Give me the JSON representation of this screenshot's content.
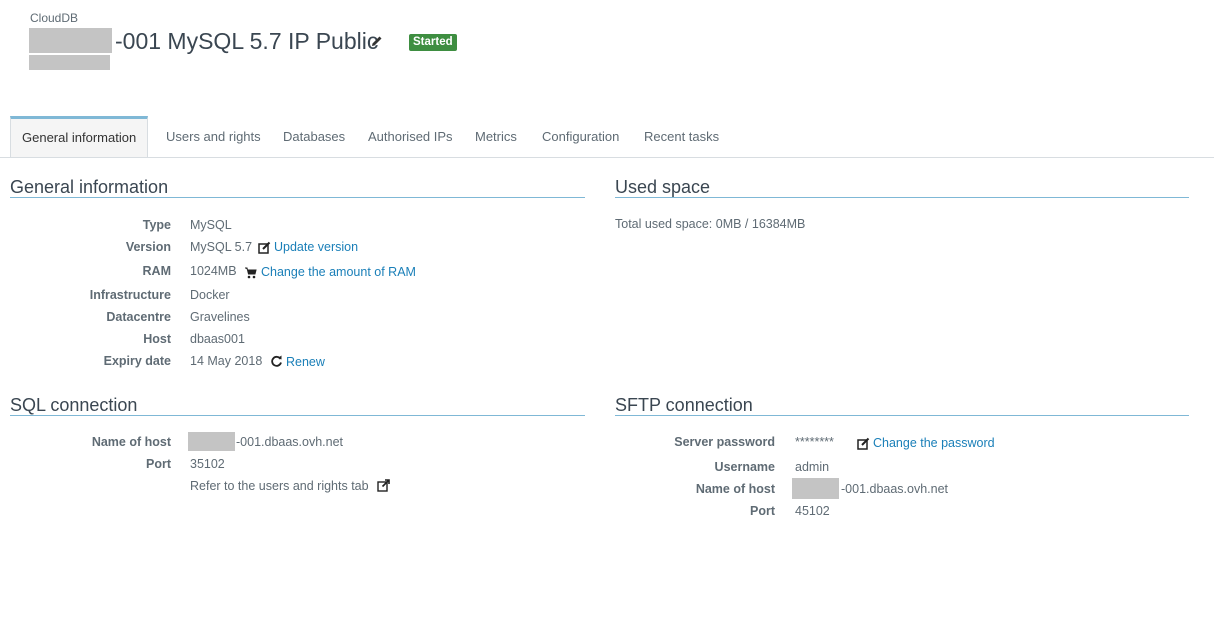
{
  "header": {
    "service_type": "CloudDB",
    "title_suffix": "-001 MySQL 5.7 IP Public",
    "status": "Started"
  },
  "tabs": [
    {
      "label": "General information"
    },
    {
      "label": "Users and rights"
    },
    {
      "label": "Databases"
    },
    {
      "label": "Authorised IPs"
    },
    {
      "label": "Metrics"
    },
    {
      "label": "Configuration"
    },
    {
      "label": "Recent tasks"
    }
  ],
  "general": {
    "title": "General information",
    "rows": [
      {
        "label": "Type",
        "value": "MySQL"
      },
      {
        "label": "Version",
        "value": "MySQL 5.7",
        "action": "Update version",
        "icon": "edit-icon"
      },
      {
        "label": "RAM",
        "value": "1024MB",
        "action": "Change the amount of RAM",
        "icon": "cart-icon"
      },
      {
        "label": "Infrastructure",
        "value": "Docker"
      },
      {
        "label": "Datacentre",
        "value": "Gravelines"
      },
      {
        "label": "Host",
        "value": "dbaas001"
      },
      {
        "label": "Expiry date",
        "value": "14 May 2018",
        "action": "Renew",
        "icon": "refresh-icon"
      }
    ]
  },
  "used_space": {
    "title": "Used space",
    "total": "Total used space: 0MB / 16384MB"
  },
  "sql": {
    "title": "SQL connection",
    "host_label": "Name of host",
    "host_suffix": "-001.dbaas.ovh.net",
    "port_label": "Port",
    "port": "35102",
    "refer_text": "Refer to the users and rights tab"
  },
  "sftp": {
    "title": "SFTP connection",
    "password_label": "Server password",
    "password": "********",
    "password_action": "Change the password",
    "username_label": "Username",
    "username": "admin",
    "host_label": "Name of host",
    "host_suffix": "-001.dbaas.ovh.net",
    "port_label": "Port",
    "port": "45102"
  },
  "colors": {
    "accent": "#7fb8d6",
    "link": "#1a7fb8",
    "status": "#3e8e41"
  }
}
